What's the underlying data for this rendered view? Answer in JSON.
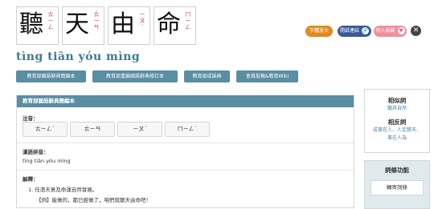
{
  "characters": [
    {
      "char": "聽",
      "zhuyin": [
        "ㄊ",
        "ㄧ",
        "ㄥ"
      ]
    },
    {
      "char": "天",
      "zhuyin": [
        "ㄊ",
        "ㄧ",
        "ㄢ"
      ]
    },
    {
      "char": "由",
      "zhuyin": [
        "ㄧ",
        "ㄡ",
        "ˊ"
      ]
    },
    {
      "char": "命",
      "zhuyin": [
        "ㄇ",
        "ㄧ",
        "ㄥ"
      ]
    }
  ],
  "toolbar": {
    "font_size_label": "字體放大",
    "open_link_label": "開啟連結",
    "add_fav_label": "列入收藏",
    "link_icon": "🔗",
    "fav_icon": "♥",
    "close_icon": "✕"
  },
  "pinyin_title": "tìng tiān yóu mìng",
  "nav": {
    "tabs": [
      "教育部國語辭典簡編本",
      "教育部重編國語辭典修訂本",
      "教育部成語典",
      "會員投稿&教育Wiki"
    ]
  },
  "panel": {
    "header": "教育部國語辭典簡編本",
    "zhuyin_label": "注音：",
    "zhuyin_boxes": [
      "ㄊㄧㄥˋ",
      "ㄊㄧㄢ",
      "ㄧㄡˊ",
      "ㄇㄧㄥˋ"
    ],
    "pinyin_label": "漢語拼音：",
    "pinyin_value": "tìng tiān yóu mìng",
    "definition_label": "解釋：",
    "definition_1": "1. 任憑天意及命運自然發展。",
    "example_1": "【例】能做的，都已經做了，咱們就聽天由命吧！"
  },
  "side": {
    "synonym_title": "相似詞",
    "synonym_links": [
      "聽其自然"
    ],
    "antonym_title": "相反詞",
    "antonym_links": [
      "成事在人、人定勝天、",
      "事在人為"
    ],
    "tools_title": "詞條功能",
    "tools_button": "轉寄詞條"
  }
}
